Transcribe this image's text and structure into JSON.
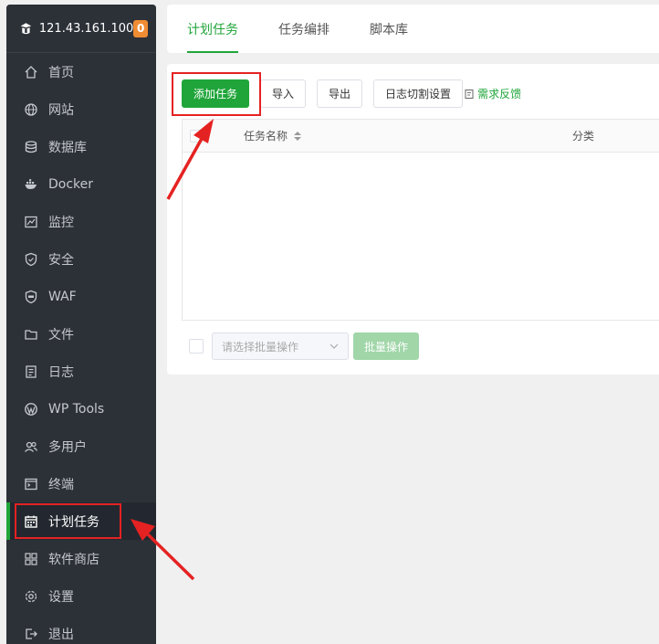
{
  "server": {
    "ip": "121.43.161.100",
    "badge": "0"
  },
  "sidebar": {
    "items": [
      {
        "label": "首页",
        "icon": "home-icon"
      },
      {
        "label": "网站",
        "icon": "globe-icon"
      },
      {
        "label": "数据库",
        "icon": "database-icon"
      },
      {
        "label": "Docker",
        "icon": "docker-icon"
      },
      {
        "label": "监控",
        "icon": "monitor-icon"
      },
      {
        "label": "安全",
        "icon": "shield-icon"
      },
      {
        "label": "WAF",
        "icon": "waf-icon"
      },
      {
        "label": "文件",
        "icon": "folder-icon"
      },
      {
        "label": "日志",
        "icon": "log-icon"
      },
      {
        "label": "WP Tools",
        "icon": "wordpress-icon"
      },
      {
        "label": "多用户",
        "icon": "users-icon"
      },
      {
        "label": "终端",
        "icon": "terminal-icon"
      },
      {
        "label": "计划任务",
        "icon": "calendar-icon",
        "active": true
      },
      {
        "label": "软件商店",
        "icon": "apps-icon"
      },
      {
        "label": "设置",
        "icon": "gear-icon"
      },
      {
        "label": "退出",
        "icon": "logout-icon"
      }
    ]
  },
  "tabs": [
    {
      "label": "计划任务",
      "active": true
    },
    {
      "label": "任务编排"
    },
    {
      "label": "脚本库"
    }
  ],
  "toolbar": {
    "add_task": "添加任务",
    "import": "导入",
    "export": "导出",
    "log_cut": "日志切割设置",
    "feedback": "需求反馈"
  },
  "table": {
    "headers": {
      "name": "任务名称",
      "category": "分类"
    }
  },
  "footer": {
    "batch_placeholder": "请选择批量操作",
    "batch_button": "批量操作"
  },
  "colors": {
    "accent": "#20a53a",
    "sidebar_bg": "#2c3138",
    "highlight": "#e52222",
    "badge": "#f08c33"
  }
}
